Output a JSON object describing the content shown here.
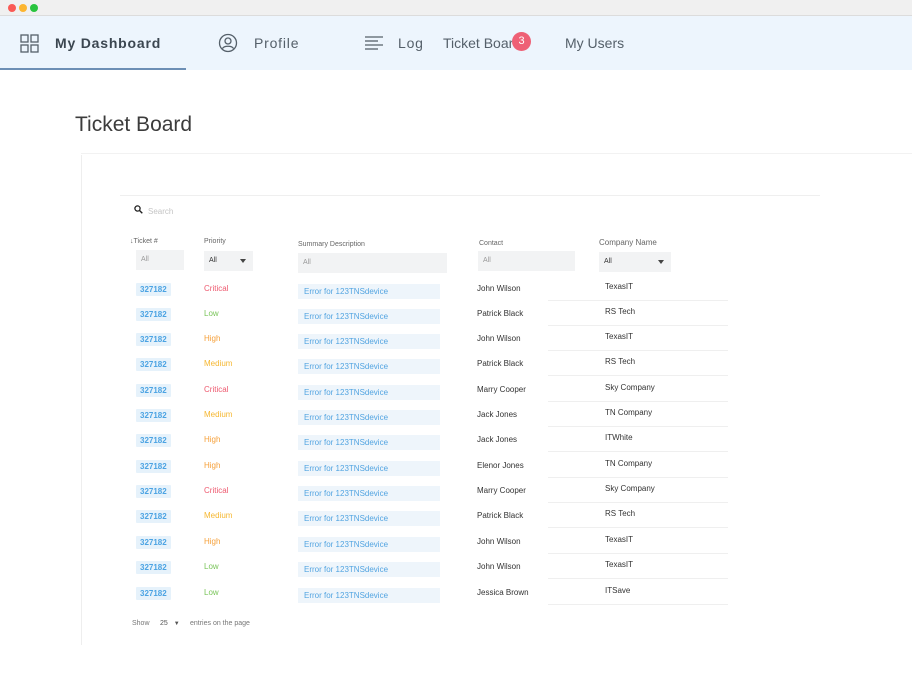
{
  "window": {
    "dots": [
      "#fa5a55",
      "#fcb530",
      "#29c43f"
    ]
  },
  "nav": {
    "items": [
      {
        "label": "My Dashboard",
        "icon": "grid-icon",
        "active": true
      },
      {
        "label": "Profile",
        "icon": "user-circle-icon"
      },
      {
        "label": "Log",
        "icon": "list-lines-icon"
      },
      {
        "label": "Ticket Board",
        "badge": "3"
      },
      {
        "label": "My Users"
      }
    ]
  },
  "page": {
    "title": "Ticket Board"
  },
  "search": {
    "placeholder": "Search"
  },
  "table": {
    "headers": {
      "ticket": "Ticket #",
      "priority": "Priority",
      "summary": "Summary Description",
      "contact": "Contact",
      "company": "Company Name"
    },
    "filters": {
      "ticket": "All",
      "priority": "All",
      "summary": "All",
      "contact": "All",
      "company": "All"
    },
    "priority_colors": {
      "Critical": "#ee5a6f",
      "Low": "#7ac55a",
      "High": "#f6a03a",
      "Medium": "#f5b731"
    },
    "rows": [
      {
        "ticket": "327182",
        "priority": "Critical",
        "summary": "Error for 123TNSdevice",
        "contact": "John Wilson",
        "company": "TexasIT"
      },
      {
        "ticket": "327182",
        "priority": "Low",
        "summary": "Error for 123TNSdevice",
        "contact": "Patrick Black",
        "company": "RS Tech"
      },
      {
        "ticket": "327182",
        "priority": "High",
        "summary": "Error for 123TNSdevice",
        "contact": "John Wilson",
        "company": "TexasIT"
      },
      {
        "ticket": "327182",
        "priority": "Medium",
        "summary": "Error for 123TNSdevice",
        "contact": "Patrick Black",
        "company": "RS Tech"
      },
      {
        "ticket": "327182",
        "priority": "Critical",
        "summary": "Error for 123TNSdevice",
        "contact": "Marry Cooper",
        "company": "Sky Company"
      },
      {
        "ticket": "327182",
        "priority": "Medium",
        "summary": "Error for 123TNSdevice",
        "contact": "Jack Jones",
        "company": "TN Company"
      },
      {
        "ticket": "327182",
        "priority": "High",
        "summary": "Error for 123TNSdevice",
        "contact": "Jack Jones",
        "company": "ITWhite"
      },
      {
        "ticket": "327182",
        "priority": "High",
        "summary": "Error for 123TNSdevice",
        "contact": "Elenor Jones",
        "company": "TN Company"
      },
      {
        "ticket": "327182",
        "priority": "Critical",
        "summary": "Error for 123TNSdevice",
        "contact": "Marry Cooper",
        "company": "Sky Company"
      },
      {
        "ticket": "327182",
        "priority": "Medium",
        "summary": "Error for 123TNSdevice",
        "contact": "Patrick Black",
        "company": "RS Tech"
      },
      {
        "ticket": "327182",
        "priority": "High",
        "summary": "Error for 123TNSdevice",
        "contact": "John Wilson",
        "company": "TexasIT"
      },
      {
        "ticket": "327182",
        "priority": "Low",
        "summary": "Error for 123TNSdevice",
        "contact": "John Wilson",
        "company": "TexasIT"
      },
      {
        "ticket": "327182",
        "priority": "Low",
        "summary": "Error for 123TNSdevice",
        "contact": "Jessica Brown",
        "company": "ITSave"
      }
    ]
  },
  "footer": {
    "show": "Show",
    "page_size": "25",
    "suffix": "entries on the page"
  }
}
